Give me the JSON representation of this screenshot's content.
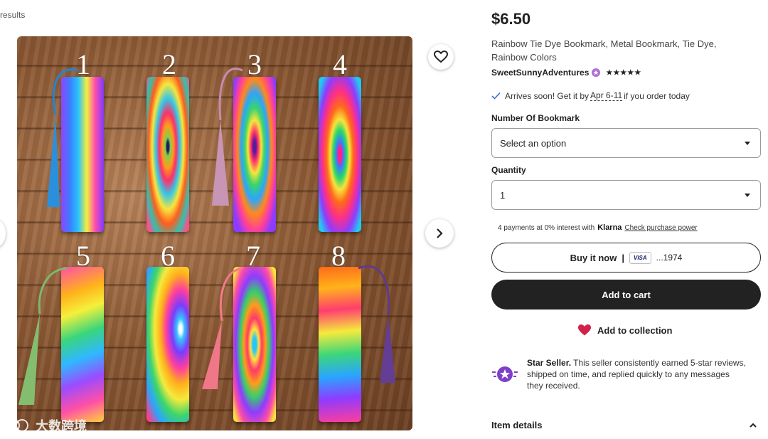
{
  "breadcrumb": {
    "results_label": "results"
  },
  "gallery": {
    "numbers": [
      "1",
      "2",
      "3",
      "4",
      "5",
      "6",
      "7",
      "8"
    ],
    "watermark": "大数跨境"
  },
  "product": {
    "price": "$6.50",
    "title": "Rainbow Tie Dye Bookmark, Metal Bookmark, Tie Dye, Rainbow Colors",
    "seller_name": "SweetSunnyAdventures",
    "rating_stars": "★★★★★",
    "arrives_prefix": "Arrives soon! Get it by",
    "arrives_date": "Apr 6-11",
    "arrives_suffix": "if you order today"
  },
  "options": {
    "bookmark_label": "Number Of Bookmark",
    "bookmark_value": "Select an option",
    "quantity_label": "Quantity",
    "quantity_value": "1"
  },
  "klarna": {
    "text": "4 payments at 0% interest with",
    "brand": "Klarna",
    "link": "Check purchase power"
  },
  "actions": {
    "buy_now": "Buy it now",
    "separator": "|",
    "card_brand": "VISA",
    "card_last4": "...1974",
    "add_to_cart": "Add to cart",
    "add_to_collection": "Add to collection"
  },
  "star_seller": {
    "title": "Star Seller.",
    "text": "This seller consistently earned 5-star reviews, shipped on time, and replied quickly to any messages they received."
  },
  "item_details": {
    "label": "Item details"
  },
  "colors": {
    "primary_dark": "#222222",
    "heart_red": "#d3224a",
    "star_purple": "#7e3fc8"
  }
}
